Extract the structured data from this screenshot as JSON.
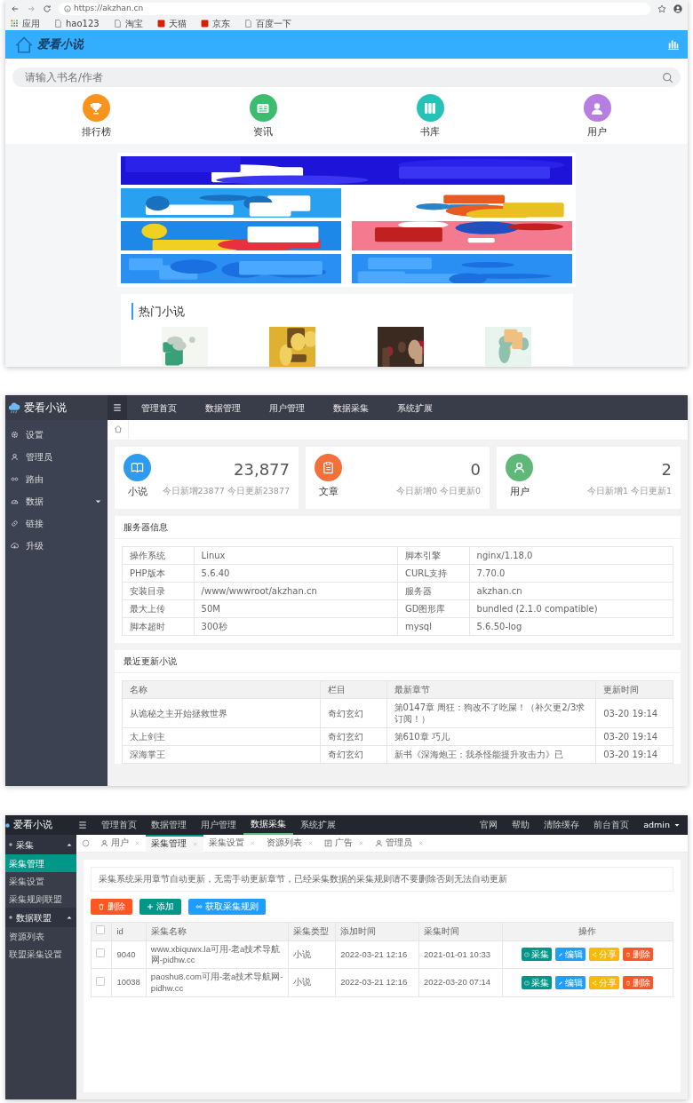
{
  "browser": {
    "url": "https://akzhan.cn",
    "bookmarks": [
      {
        "label": "应用",
        "kind": "apps"
      },
      {
        "label": "hao123",
        "kind": "page"
      },
      {
        "label": "淘宝",
        "kind": "page"
      },
      {
        "label": "天猫",
        "kind": "brand"
      },
      {
        "label": "京东",
        "kind": "brand"
      },
      {
        "label": "百度一下",
        "kind": "page"
      }
    ]
  },
  "site": {
    "logo": "爱看小说",
    "search": {
      "placeholder": "请输入书名/作者"
    },
    "nav": [
      {
        "label": "排行榜",
        "kind": "trophy",
        "color": "#f7931e"
      },
      {
        "label": "资讯",
        "kind": "news",
        "color": "#3dbb6f"
      },
      {
        "label": "书库",
        "kind": "books",
        "color": "#26c2b8"
      },
      {
        "label": "用户",
        "kind": "user",
        "color": "#b57ee0"
      }
    ],
    "hot": {
      "title": "热门小说"
    }
  },
  "admin": {
    "brand": "爱看小说",
    "topnav": [
      "管理首页",
      "数据管理",
      "用户管理",
      "数据采集",
      "系统扩展"
    ],
    "sidebar": [
      {
        "label": "设置",
        "kind": "link"
      },
      {
        "label": "管理员",
        "kind": "link"
      },
      {
        "label": "路由",
        "kind": "link"
      },
      {
        "label": "数据",
        "kind": "group"
      },
      {
        "label": "链接",
        "kind": "link"
      },
      {
        "label": "升级",
        "kind": "link"
      }
    ],
    "stats": [
      {
        "label": "小说",
        "value": "23,877",
        "sub": "今日新增23877 今日更新23877",
        "kind": "book",
        "color": "#2d9cf0"
      },
      {
        "label": "文章",
        "value": "0",
        "sub": "今日新增0 今日更新0",
        "kind": "doc",
        "color": "#f46f3a"
      },
      {
        "label": "用户",
        "value": "2",
        "sub": "今日新增1 今日更新1",
        "kind": "user",
        "color": "#5fb878"
      }
    ],
    "server": {
      "title": "服务器信息",
      "rows": [
        [
          "操作系统",
          "Linux",
          "脚本引擎",
          "nginx/1.18.0"
        ],
        [
          "PHP版本",
          "5.6.40",
          "CURL支持",
          "7.70.0"
        ],
        [
          "安装目录",
          "/www/wwwroot/akzhan.cn",
          "服务器",
          "akzhan.cn"
        ],
        [
          "最大上传",
          "50M",
          "GD图形库",
          "bundled (2.1.0 compatible)"
        ],
        [
          "脚本超时",
          "300秒",
          "mysql",
          "5.6.50-log"
        ]
      ]
    },
    "recent": {
      "title": "最近更新小说",
      "columns": [
        "名称",
        "栏目",
        "最新章节",
        "更新时间"
      ],
      "rows": [
        [
          "从诡秘之主开始拯救世界",
          "奇幻玄幻",
          "第0147章 周狂：狗改不了吃屎！（补欠更2/3求订阅！）",
          "03-20 19:14"
        ],
        [
          "太上剑主",
          "奇幻玄幻",
          "第610章 巧儿",
          "03-20 19:14"
        ],
        [
          "深海掌王",
          "奇幻玄幻",
          "新书《深海炮王：我杀怪能提升攻击力》已",
          "03-20 19:14"
        ]
      ]
    }
  },
  "collector": {
    "brand": "爱看小说",
    "topnav": [
      {
        "label": "管理首页",
        "selected": false
      },
      {
        "label": "数据管理",
        "selected": false
      },
      {
        "label": "用户管理",
        "selected": false
      },
      {
        "label": "数据采集",
        "selected": true
      },
      {
        "label": "系统扩展",
        "selected": false
      }
    ],
    "right_links": [
      "官网",
      "帮助",
      "清除缓存",
      "前台首页"
    ],
    "user": "admin",
    "sidebar": [
      {
        "label": "采集",
        "expanded": true,
        "children": [
          {
            "label": "采集管理",
            "selected": true
          },
          {
            "label": "采集设置",
            "selected": false
          },
          {
            "label": "采集规则联盟",
            "selected": false
          }
        ]
      },
      {
        "label": "数据联盟",
        "expanded": true,
        "children": [
          {
            "label": "资源列表",
            "selected": false
          },
          {
            "label": "联盟采集设置",
            "selected": false
          }
        ]
      }
    ],
    "tabs": [
      {
        "label": "用户",
        "kind": "user",
        "selected": false
      },
      {
        "label": "采集管理",
        "kind": "plain",
        "selected": true
      },
      {
        "label": "采集设置",
        "kind": "plain",
        "selected": false
      },
      {
        "label": "资源列表",
        "kind": "plain",
        "selected": false
      },
      {
        "label": "广告",
        "kind": "ad",
        "selected": false
      },
      {
        "label": "管理员",
        "kind": "user",
        "selected": false
      }
    ],
    "notice": "采集系统采用章节自动更新，无需手动更新章节，已经采集数据的采集规则请不要删除否则无法自动更新",
    "toolbar": [
      {
        "label": "删除",
        "kind": "delete",
        "color": "#ff5722"
      },
      {
        "label": "添加",
        "kind": "add",
        "color": "#009688"
      },
      {
        "label": "获取采集规则",
        "kind": "link",
        "color": "#1e9fff"
      }
    ],
    "table": {
      "all_checked": false,
      "columns": [
        "id",
        "采集名称",
        "采集类型",
        "添加时间",
        "采集时间",
        "操作"
      ],
      "rows": [
        {
          "checked": false,
          "cells": [
            "9040",
            "www.xbiquwx.la可用-老a技术导航网-pidhw.cc",
            "小说",
            "2022-03-21 12:16",
            "2021-01-01 10:33"
          ],
          "actions": [
            {
              "label": "采集",
              "kind": "collect",
              "color": "#009688"
            },
            {
              "label": "编辑",
              "kind": "edit",
              "color": "#1e9fff"
            },
            {
              "label": "分享",
              "kind": "share",
              "color": "#ffb800"
            },
            {
              "label": "删除",
              "kind": "delete",
              "color": "#ff5722"
            }
          ]
        },
        {
          "checked": false,
          "cells": [
            "10038",
            "paoshu8.com可用-老a技术导航网-pidhw.cc",
            "小说",
            "2022-03-21 12:16",
            "2022-03-20 07:14"
          ],
          "actions": [
            {
              "label": "采集",
              "kind": "collect",
              "color": "#009688"
            },
            {
              "label": "编辑",
              "kind": "edit",
              "color": "#1e9fff"
            },
            {
              "label": "分享",
              "kind": "share",
              "color": "#ffb800"
            },
            {
              "label": "删除",
              "kind": "delete",
              "color": "#ff5722"
            }
          ]
        }
      ]
    }
  }
}
